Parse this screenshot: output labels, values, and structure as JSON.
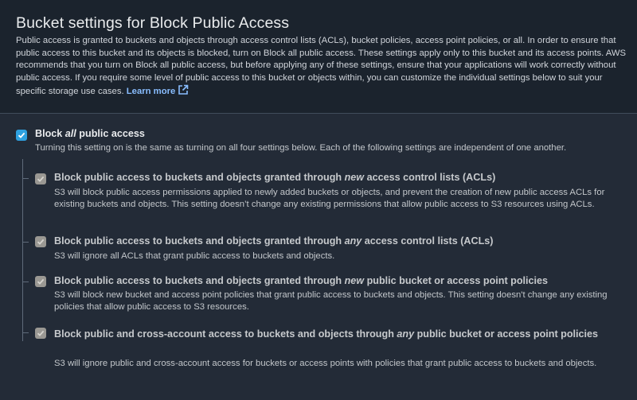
{
  "header": {
    "title": "Bucket settings for Block Public Access",
    "description": "Public access is granted to buckets and objects through access control lists (ACLs), bucket policies, access point policies, or all. In order to ensure that public access to this bucket and its objects is blocked, turn on Block all public access. These settings apply only to this bucket and its access points. AWS recommends that you turn on Block all public access, but before applying any of these settings, ensure that your applications will work correctly without public access. If you require some level of public access to this bucket or objects within, you can customize the individual settings below to suit your specific storage use cases.",
    "learn_more": "Learn more",
    "learn_more_icon": "external-link-icon"
  },
  "block_all": {
    "checked": true,
    "title_pre": "Block ",
    "title_em": "all",
    "title_post": " public access",
    "description": "Turning this setting on is the same as turning on all four settings below. Each of the following settings are independent of one another."
  },
  "options": [
    {
      "checked": true,
      "title_pre": "Block public access to buckets and objects granted through ",
      "title_em": "new",
      "title_post": " access control lists (ACLs)",
      "description": "S3 will block public access permissions applied to newly added buckets or objects, and prevent the creation of new public access ACLs for existing buckets and objects. This setting doesn’t change any existing permissions that allow public access to S3 resources using ACLs."
    },
    {
      "checked": true,
      "title_pre": "Block public access to buckets and objects granted through ",
      "title_em": "any",
      "title_post": " access control lists (ACLs)",
      "description": "S3 will ignore all ACLs that grant public access to buckets and objects."
    },
    {
      "checked": true,
      "title_pre": "Block public access to buckets and objects granted through ",
      "title_em": "new",
      "title_post": " public bucket or access point policies",
      "description": "S3 will block new bucket and access point policies that grant public access to buckets and objects. This setting doesn't change any existing policies that allow public access to S3 resources."
    },
    {
      "checked": true,
      "title_pre": "Block public and cross-account access to buckets and objects through ",
      "title_em": "any",
      "title_post": " public bucket or access point policies",
      "description": "S3 will ignore public and cross-account access for buckets or access points with policies that grant public access to buckets and objects."
    }
  ],
  "colors": {
    "accent": "#2ea1e0",
    "disabled_checkbox": "#9a9893",
    "link": "#89bdff"
  }
}
